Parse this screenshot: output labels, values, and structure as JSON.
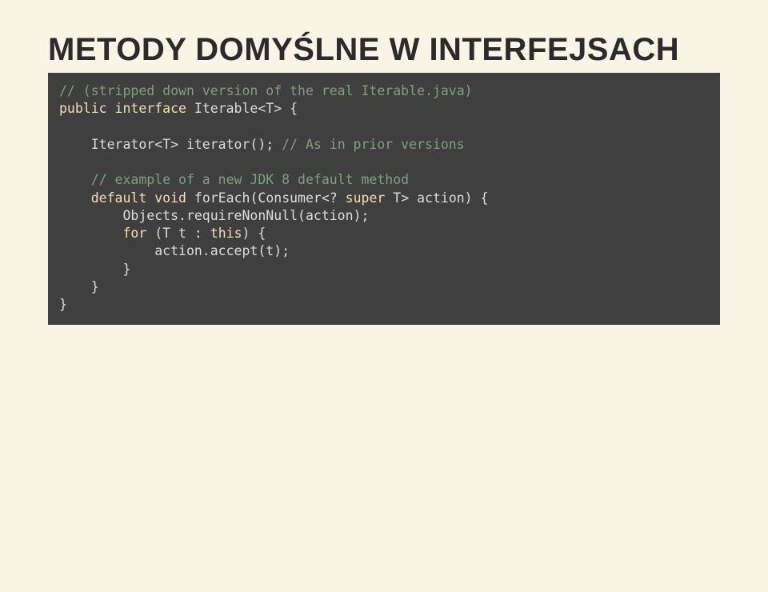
{
  "slide": {
    "title": "METODY DOMYŚLNE W INTERFEJSACH"
  },
  "code": {
    "c1": "// (stripped down version of the real Iterable.java)",
    "l2a": "public",
    "l2b": " ",
    "l2c": "interface",
    "l2d": " Iterable<T> {",
    "l3a": "    Iterator<T> iterator(); ",
    "l3b": "// As in prior versions",
    "c4": "    // example of a new JDK 8 default method",
    "l5a": "    ",
    "l5b": "default",
    "l5c": " ",
    "l5d": "void",
    "l5e": " forEach(Consumer<? ",
    "l5f": "super",
    "l5g": " T> action) {",
    "l6": "        Objects.requireNonNull(action);",
    "l7a": "        ",
    "l7b": "for",
    "l7c": " (T t : ",
    "l7d": "this",
    "l7e": ") {",
    "l8": "            action.accept(t);",
    "l9": "        }",
    "l10": "    }",
    "l11": "}"
  }
}
